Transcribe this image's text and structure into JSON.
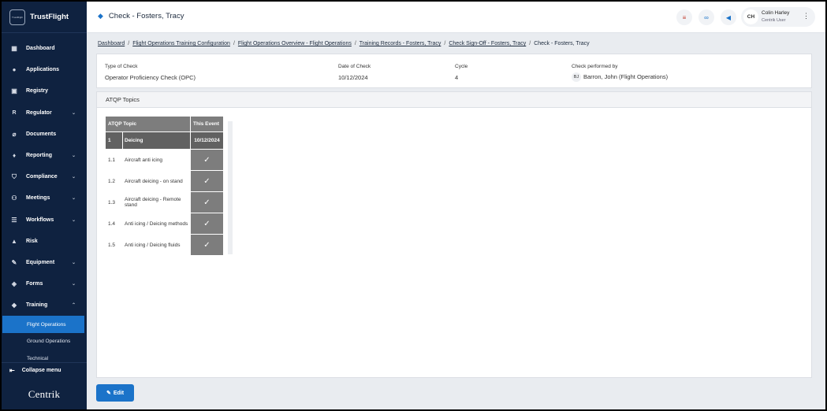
{
  "brand": {
    "name": "TrustFlight",
    "logo_text": "TrustFlight"
  },
  "sidebar": {
    "items": [
      {
        "label": "Dashboard",
        "icon": "dashboard-icon"
      },
      {
        "label": "Applications",
        "icon": "user-icon"
      },
      {
        "label": "Registry",
        "icon": "book-icon"
      },
      {
        "label": "Regulator",
        "icon": "regulator-r-icon"
      },
      {
        "label": "Documents",
        "icon": "paperclip-icon"
      },
      {
        "label": "Reporting",
        "icon": "flame-icon"
      },
      {
        "label": "Compliance",
        "icon": "shield-icon"
      },
      {
        "label": "Meetings",
        "icon": "meeting-icon"
      },
      {
        "label": "Workflows",
        "icon": "workflow-icon"
      },
      {
        "label": "Risk",
        "icon": "warning-icon"
      },
      {
        "label": "Equipment",
        "icon": "wrench-icon"
      },
      {
        "label": "Forms",
        "icon": "forms-icon"
      },
      {
        "label": "Training",
        "icon": "graduation-cap-icon"
      }
    ],
    "training_sub": [
      "Flight Operations",
      "Ground Operations",
      "Technical"
    ],
    "collapse_label": "Collapse menu",
    "footer_logo": "Centrik"
  },
  "header": {
    "title": "Check - Fosters, Tracy",
    "user": {
      "initials": "CH",
      "name": "Colin Harley",
      "role": "Centrik User"
    }
  },
  "breadcrumb": [
    "Dashboard",
    "Flight Operations Training Configuration",
    "Flight Operations Overview - Flight Operations",
    "Training Records - Fosters, Tracy",
    "Check Sign-Off - Fosters, Tracy",
    "Check - Fosters, Tracy"
  ],
  "info": {
    "type_label": "Type of Check",
    "type_value": "Operator Proficiency Check (OPC)",
    "date_label": "Date of Check",
    "date_value": "10/12/2024",
    "cycle_label": "Cycle",
    "cycle_value": "4",
    "performed_label": "Check performed by",
    "performed_initials": "BJ",
    "performed_value": "Barron, John (Flight Operations)"
  },
  "atqp": {
    "title": "ATQP Topics",
    "col_topic": "ATQP Topic",
    "col_event": "This Event",
    "section": {
      "num": "1",
      "name": "Deicing",
      "date": "10/12/2024"
    },
    "rows": [
      {
        "num": "1.1",
        "topic": "Aircraft anti icing",
        "mark": "✓"
      },
      {
        "num": "1.2",
        "topic": "Aircraft deicing - on stand",
        "mark": "✓"
      },
      {
        "num": "1.3",
        "topic": "Aircraft deicing - Remote stand",
        "mark": "✓"
      },
      {
        "num": "1.4",
        "topic": "Anti icing / Deicing methods",
        "mark": "✓"
      },
      {
        "num": "1.5",
        "topic": "Anti icing / Deicing fluids",
        "mark": "✓"
      }
    ]
  },
  "actions": {
    "edit_label": "Edit"
  }
}
